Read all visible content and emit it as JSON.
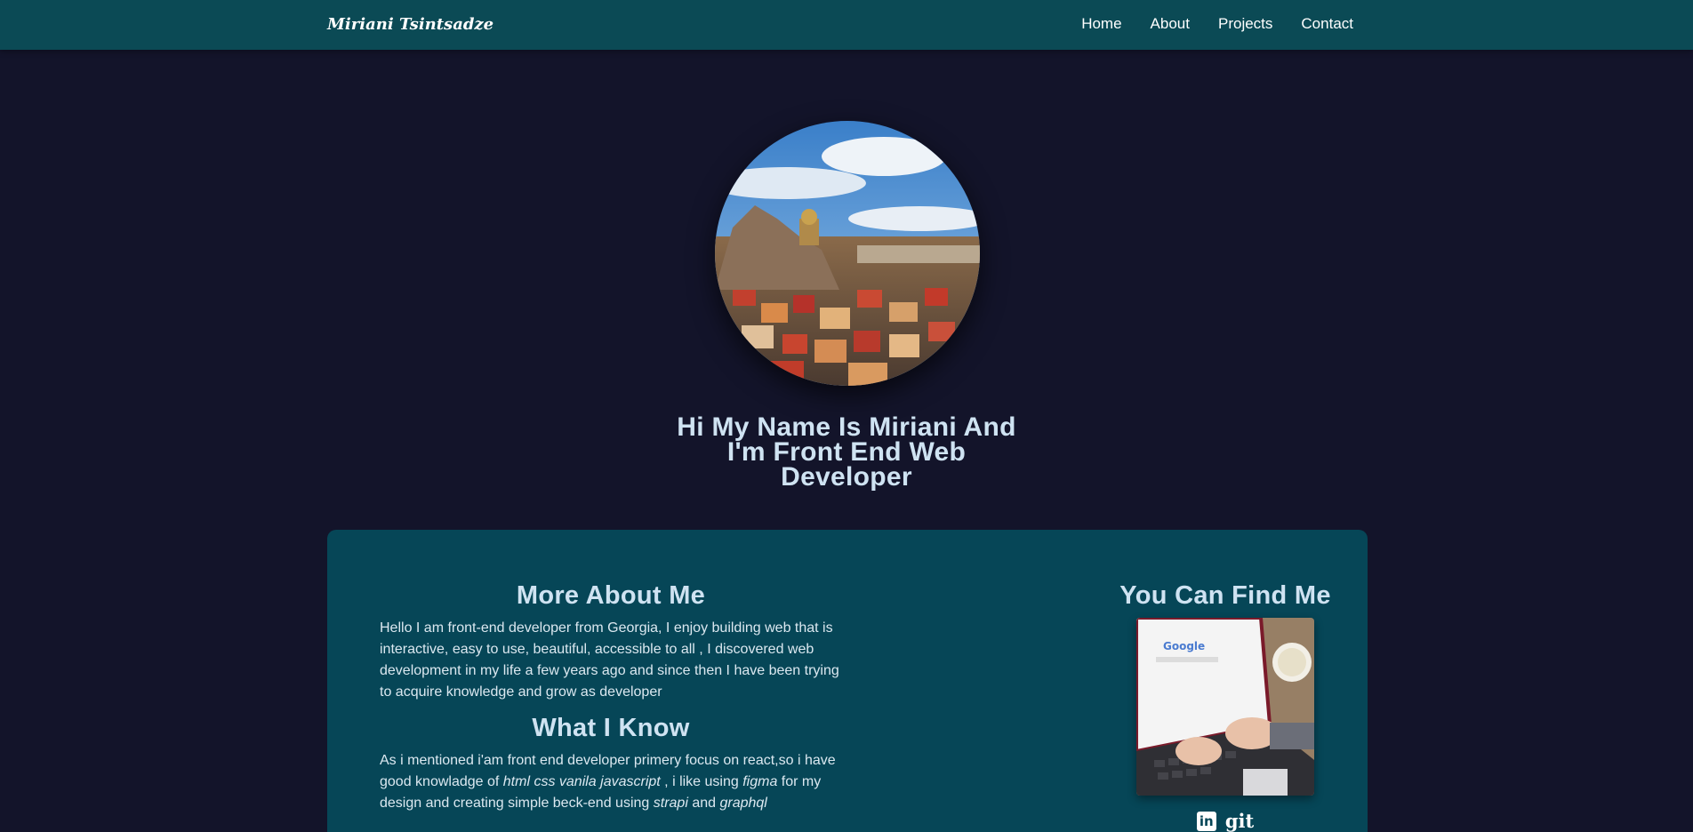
{
  "brand": "Miriani Tsintsadze",
  "nav": [
    "Home",
    "About",
    "Projects",
    "Contact"
  ],
  "hero": {
    "title": "Hi My Name Is Miriani And I'm Front End Web Developer"
  },
  "about": {
    "title": "More About Me",
    "text": "Hello I am front-end developer from Georgia, I enjoy building web that is interactive, easy to use, beautiful, accessible to all , I discovered web development in my life a few years ago and since then I have been trying to acquire knowledge and grow as developer"
  },
  "know": {
    "title": "What I Know",
    "t1": "As i mentioned i'am front end developer primery focus on react,so i have good knowladge of ",
    "e1": "html css vanila javascript",
    "t2": " , i like using ",
    "e2": "figma",
    "t3": " for my design and creating simple beck-end using ",
    "e3": "strapi",
    "t4": " and ",
    "e4": "graphql"
  },
  "find": {
    "title": "You Can Find Me",
    "linkedin_glyph": "in",
    "git_label": "git",
    "photo_logo": "Google"
  },
  "colors": {
    "background": "#13142a",
    "navbar": "#0b4a55",
    "panel": "#064657",
    "heading": "#cfe3f2"
  }
}
